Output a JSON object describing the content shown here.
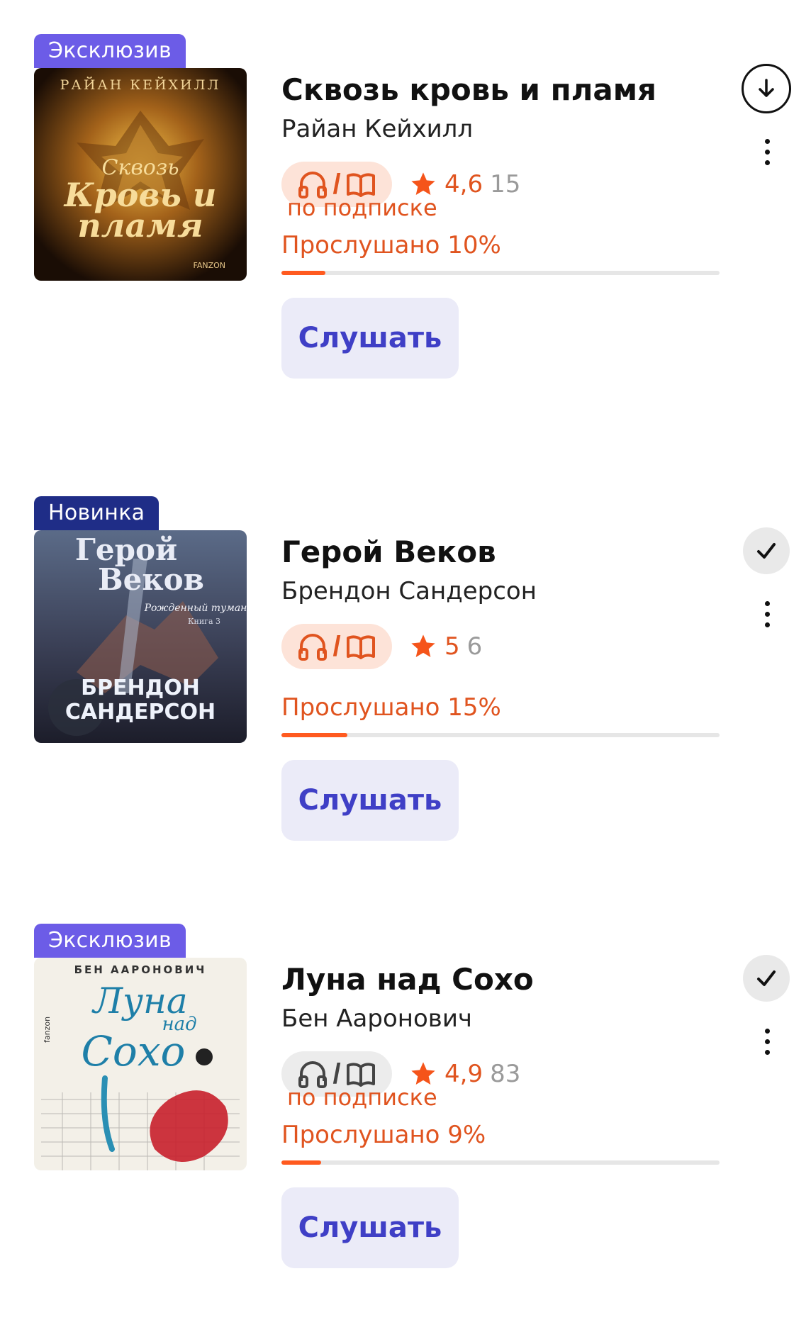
{
  "colors": {
    "accent": "#e0541f",
    "progress": "#ff5a1f",
    "badge_exclusive": "#6c5ce7",
    "badge_new": "#1f2d87",
    "button_bg": "#ebebf8",
    "button_text": "#3f3fc6"
  },
  "books": [
    {
      "badge": "Эксклюзив",
      "cover_text": {
        "author": "РАЙАН КЕЙХИЛЛ",
        "line1": "Сквозь",
        "line2": "Кровь и",
        "line3": "пламя",
        "publisher": "FANZON"
      },
      "title": "Сквозь кровь и пламя",
      "author": "Райан Кейхилл",
      "rating": "4,6",
      "rating_count": "15",
      "subscription": "по подписке",
      "progress_label": "Прослушано 10%",
      "progress": 0.1,
      "listen_label": "Слушать",
      "status_icon": "download-icon"
    },
    {
      "badge": "Новинка",
      "cover_text": {
        "line1": "Герой",
        "line2": "Веков",
        "subtitle": "Рожденный туманом",
        "book": "Книга 3",
        "author1": "БРЕНДОН",
        "author2": "САНДЕРСОН"
      },
      "title": "Герой Веков",
      "author": "Брендон Сандерсон",
      "rating": "5",
      "rating_count": "6",
      "progress_label": "Прослушано 15%",
      "progress": 0.15,
      "listen_label": "Слушать",
      "status_icon": "check-icon"
    },
    {
      "badge": "Эксклюзив",
      "cover_text": {
        "author": "БЕН ААРОНОВИЧ",
        "line1": "Луна",
        "line2": "над",
        "line3": "Сохо",
        "publisher": "fanzon"
      },
      "title": "Луна над Сохо",
      "author": "Бен Ааронович",
      "rating": "4,9",
      "rating_count": "83",
      "subscription": "по подписке",
      "progress_label": "Прослушано 9%",
      "progress": 0.09,
      "listen_label": "Слушать",
      "status_icon": "check-icon"
    }
  ]
}
